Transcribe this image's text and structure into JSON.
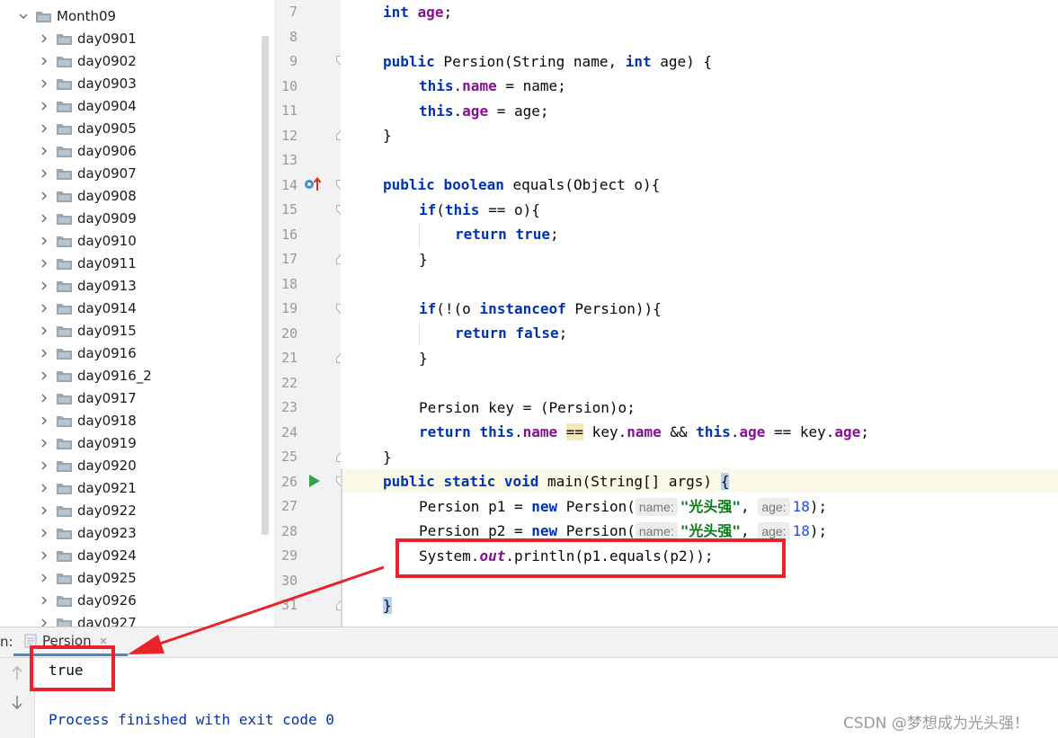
{
  "project_tree": {
    "root": "Month09",
    "items": [
      "day0901",
      "day0902",
      "day0903",
      "day0904",
      "day0905",
      "day0906",
      "day0907",
      "day0908",
      "day0909",
      "day0910",
      "day0911",
      "day0913",
      "day0914",
      "day0915",
      "day0916",
      "day0916_2",
      "day0917",
      "day0918",
      "day0919",
      "day0920",
      "day0921",
      "day0922",
      "day0923",
      "day0924",
      "day0925",
      "day0926",
      "day0927"
    ]
  },
  "editor": {
    "line_numbers": [
      "7",
      "8",
      "9",
      "10",
      "11",
      "12",
      "13",
      "14",
      "15",
      "16",
      "17",
      "18",
      "19",
      "20",
      "21",
      "22",
      "23",
      "24",
      "25",
      "26",
      "27",
      "28",
      "29",
      "30",
      "31"
    ],
    "tokens": {
      "l7_kw": "int",
      "l7_fld": "age",
      "l7_tail": ";",
      "l9_kw1": "public",
      "l9_a": " Persion(String name, ",
      "l9_kw2": "int",
      "l9_b": " age) {",
      "l10_kw": "this",
      "l10_dot": ".",
      "l10_fld": "name",
      "l10_tail": " = name;",
      "l11_kw": "this",
      "l11_dot": ".",
      "l11_fld": "age",
      "l11_tail": " = age;",
      "l12": "}",
      "l14_kw1": "public",
      "l14_sp": " ",
      "l14_kw2": "boolean",
      "l14_tail": " equals(Object o){",
      "l15_kw1": "if",
      "l15_a": "(",
      "l15_kw2": "this",
      "l15_b": " == o){",
      "l16_kw1": "return",
      "l16_sp": " ",
      "l16_kw2": "true",
      "l16_tail": ";",
      "l17": "}",
      "l19_kw1": "if",
      "l19_a": "(!(o ",
      "l19_kw2": "instanceof",
      "l19_b": " Persion)){",
      "l20_kw1": "return",
      "l20_sp": " ",
      "l20_kw2": "false",
      "l20_tail": ";",
      "l21": "}",
      "l23": "Persion key = (Persion)o;",
      "l24_kw1": "return",
      "l24_sp1": " ",
      "l24_kw2": "this",
      "l24_dot1": ".",
      "l24_f1": "name",
      "l24_sp2": " ",
      "l24_eq": "==",
      "l24_a": " key.",
      "l24_f2": "name",
      "l24_b": " && ",
      "l24_kw3": "this",
      "l24_dot2": ".",
      "l24_f3": "age",
      "l24_c": " == key.",
      "l24_f4": "age",
      "l24_d": ";",
      "l25": "}",
      "l26_kw1": "public",
      "l26_sp1": " ",
      "l26_kw2": "static",
      "l26_sp2": " ",
      "l26_kw3": "void",
      "l26_a": " main(String[] args) ",
      "l26_br": "{",
      "l27_a": "Persion p1 = ",
      "l27_kw": "new",
      "l27_b": " Persion(",
      "l27_h1": "name:",
      "l27_str": "\"光头强\"",
      "l27_c": ", ",
      "l27_h2": "age:",
      "l27_num": "18",
      "l27_d": ");",
      "l28_a": "Persion p2 = ",
      "l28_kw": "new",
      "l28_b": " Persion(",
      "l28_h1": "name:",
      "l28_str": "\"光头强\"",
      "l28_c": ", ",
      "l28_h2": "age:",
      "l28_num": "18",
      "l28_d": ");",
      "l29_a": "System.",
      "l29_out": "out",
      "l29_b": ".println(p1.equals(p2));",
      "l31": "}"
    }
  },
  "run_panel": {
    "label_prefix": "n:",
    "tab_label": "Persion",
    "output_line1": "true",
    "output_line2": "Process finished with exit code 0"
  },
  "watermark": "CSDN @梦想成为光头强！",
  "colors": {
    "annotation_red": "#e8232c",
    "keyword_blue": "#0033b3",
    "field_purple": "#871094",
    "string_green": "#067d17"
  }
}
